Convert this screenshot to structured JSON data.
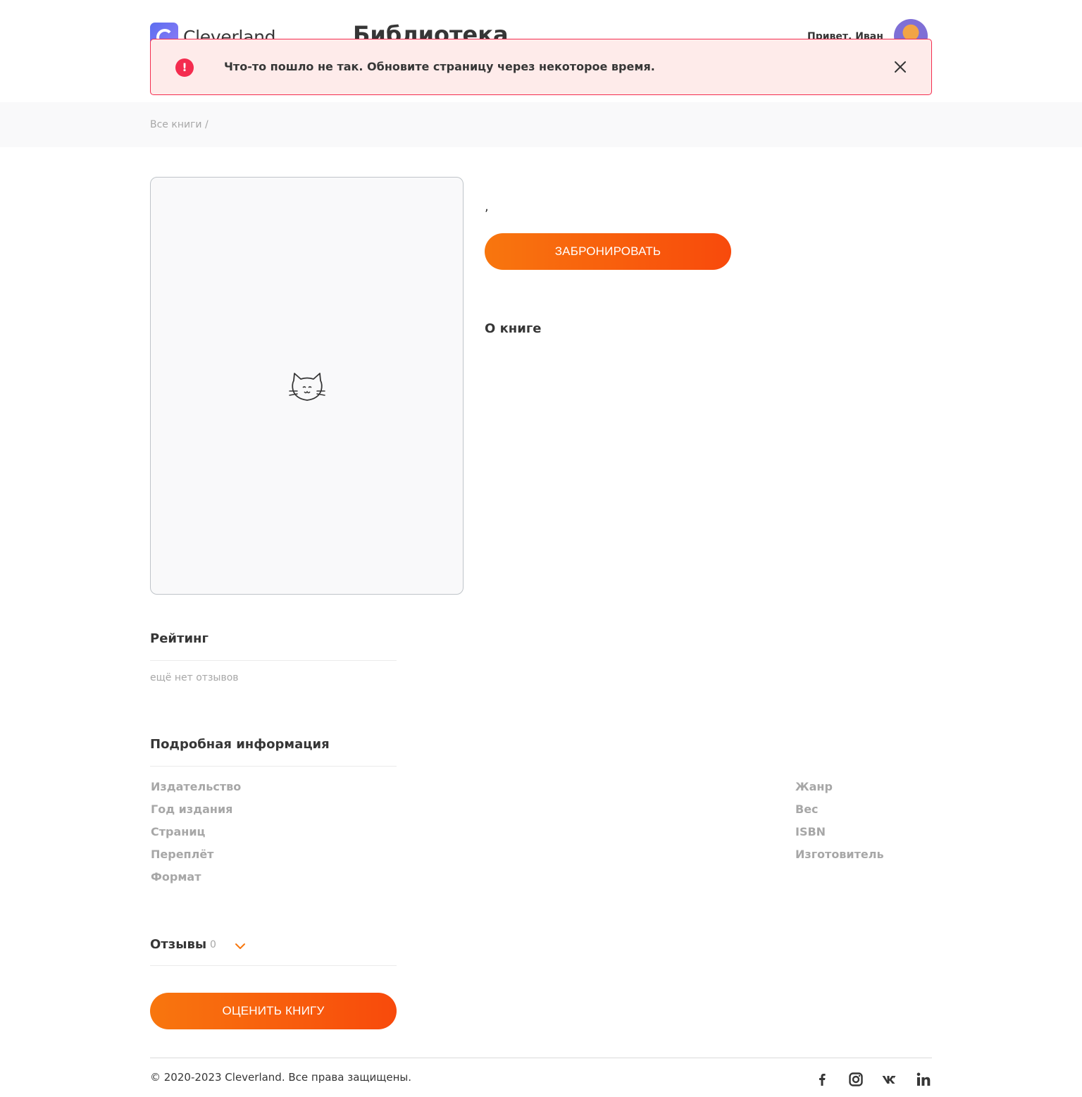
{
  "header": {
    "logo_text": "Cleverland",
    "page_title": "Библиотека",
    "greeting": "Привет, Иван"
  },
  "toast": {
    "message": "Что-то пошло не так. Обновите страницу через некоторое время.",
    "icon": "exclamation-icon",
    "close_icon": "close-icon",
    "color": "#f42c4f"
  },
  "breadcrumb": {
    "text": "Все книги /"
  },
  "book": {
    "cover_icon": "cat-icon",
    "authors": ",",
    "book_button": "ЗАБРОНИРОВАТЬ",
    "about_title": "О книге"
  },
  "rating": {
    "title": "Рейтинг",
    "empty": "ещё нет отзывов"
  },
  "details": {
    "title": "Подробная информация",
    "left": [
      "Издательство",
      "Год издания",
      "Страниц",
      "Переплёт",
      "Формат"
    ],
    "right": [
      "Жанр",
      "Вес",
      "ISBN",
      "Изготовитель"
    ]
  },
  "reviews": {
    "title": "Отзывы",
    "count": "0",
    "toggle_icon": "chevron-down-icon",
    "rate_button": "ОЦЕНИТЬ КНИГУ"
  },
  "footer": {
    "copyright": "© 2020-2023 Cleverland. Все права защищены.",
    "social": [
      "facebook-icon",
      "instagram-icon",
      "vk-icon",
      "linkedin-icon"
    ]
  },
  "colors": {
    "accent_start": "#f8760e",
    "accent_end": "#f84a0c",
    "error": "#f42c4f",
    "muted": "#a7a7a7"
  }
}
